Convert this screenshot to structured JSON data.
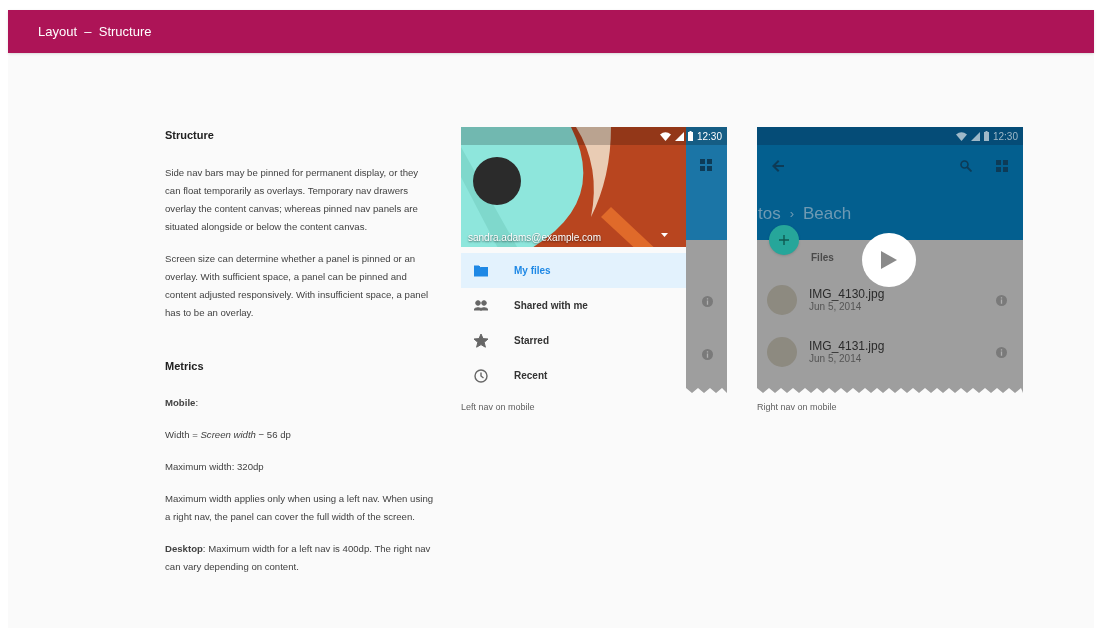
{
  "header": {
    "title": "Layout  –  Structure"
  },
  "sections": [
    {
      "heading": "Structure",
      "paragraphs": [
        "Side nav bars may be pinned for permanent display, or they can float temporarily as overlays. Temporary nav drawers overlay the content canvas; whereas pinned nav panels are situated alongside or below the content canvas.",
        "Screen size can determine whether a panel is pinned or an overlay. With sufficient space, a panel can be pinned and content adjusted responsively. With insufficient space, a panel has to be an overlay."
      ]
    },
    {
      "heading": "Metrics",
      "paragraphs": [
        "**Mobile**:",
        "Width = *Screen width* − 56 dp",
        "Maximum width: 320dp",
        "Maximum width applies only when using a left nav. When using a right nav, the panel can cover the full width of the screen.",
        "**Desktop**: Maximum width for a left nav is 400dp. The right nav can vary depending on content."
      ]
    }
  ],
  "left_figure": {
    "time": "12:30",
    "account_email": "sandra.adams@example.com",
    "nav_items": [
      {
        "kind": "folder",
        "label": "My files",
        "selected": true
      },
      {
        "kind": "people",
        "label": "Shared with me",
        "selected": false
      },
      {
        "kind": "star",
        "label": "Starred",
        "selected": false
      },
      {
        "kind": "clock",
        "label": "Recent",
        "selected": false
      }
    ],
    "caption": "Left nav on mobile"
  },
  "right_figure": {
    "time": "12:30",
    "breadcrumb_parent": "tos",
    "breadcrumb_separator": "›",
    "breadcrumb_current": "Beach",
    "section_label": "Files",
    "files": [
      {
        "name": "IMG_4130.jpg",
        "date": "Jun 5, 2014"
      },
      {
        "name": "IMG_4131.jpg",
        "date": "Jun 5, 2014"
      }
    ],
    "caption": "Right nav on mobile"
  }
}
